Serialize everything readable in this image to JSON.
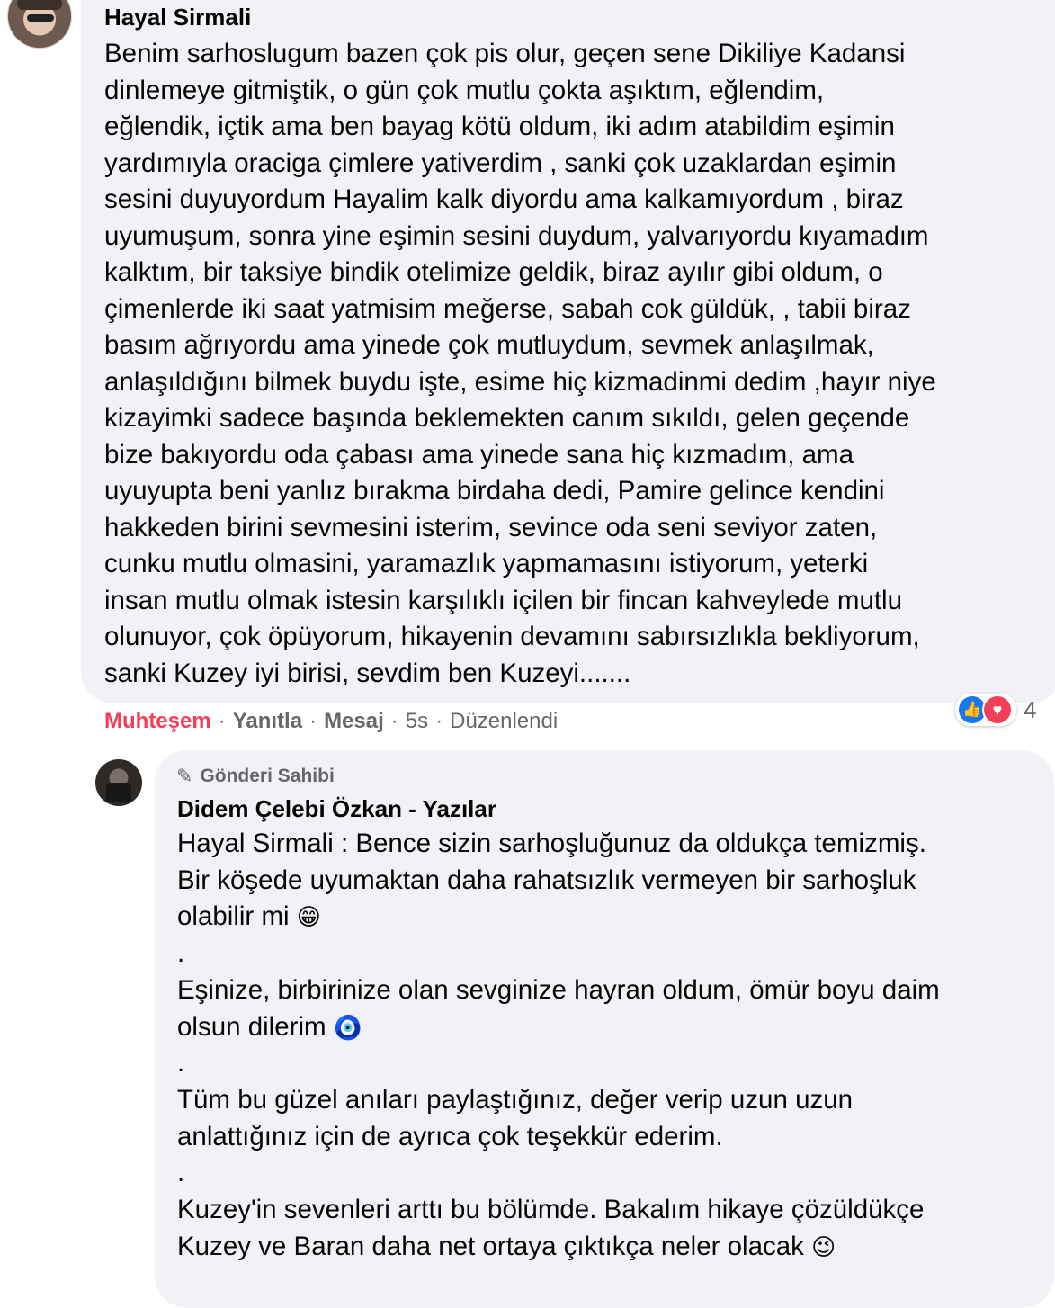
{
  "comment1": {
    "author": "Hayal Sirmali",
    "text": "Benim sarhoslugum bazen çok pis olur, geçen sene Dikiliye Kadansi\ndinlemeye gitmiştik, o gün çok mutlu çokta aşıktım, eğlendim,\neğlendik, içtik ama ben bayag kötü oldum, iki adım atabildim eşimin\nyardımıyla oraciga çimlere yativerdim , sanki çok uzaklardan eşimin\nsesini duyuyordum Hayalim kalk diyordu ama kalkamıyordum , biraz\nuyumuşum, sonra yine eşimin sesini duydum, yalvarıyordu kıyamadım\nkalktım, bir taksiye bindik otelimize geldik, biraz ayılır gibi oldum, o\nçimenlerde iki saat yatmisim meğerse, sabah cok güldük, , tabii biraz\nbasım ağrıyordu ama yinede çok mutluydum, sevmek anlaşılmak,\nanlaşıldığını bilmek buydu işte, esime hiç kizmadinmi dedim ,hayır niye\nkizayimki sadece başında beklemekten canım sıkıldı, gelen geçende\nbize bakıyordu oda çabası ama yinede sana hiç kızmadım, ama\nuyuyupta beni yanlız bırakma birdaha dedi, Pamire gelince kendini\nhakkeden birini sevmesini isterim, sevince oda seni seviyor zaten,\ncunku mutlu olmasini, yaramazlık yapmamasını istiyorum, yeterki\ninsan mutlu olmak istesin karşılıklı içilen bir fincan kahveylede mutlu\nolunuyor, çok öpüyorum, hikayenin devamını sabırsızlıkla bekliyorum,\nsanki Kuzey iyi birisi, sevdim ben Kuzeyi.......",
    "actions": {
      "reaction": "Muhteşem",
      "reply": "Yanıtla",
      "message": "Mesaj",
      "time": "5s",
      "edited": "Düzenlendi"
    },
    "reaction_count": "4",
    "reaction_icons": [
      "like-icon",
      "love-icon"
    ]
  },
  "comment2": {
    "badge": "Gönderi Sahibi",
    "author": "Didem Çelebi Özkan - Yazılar",
    "text_part1": "Hayal Sirmali : Bence sizin sarhoşluğunuz da oldukça temizmiş.\nBir köşede uyumaktan daha rahatsızlık vermeyen bir sarhoşluk\nolabilir mi ",
    "emoji1": "😁",
    "text_part2": "\n.\nEşinize, birbirinize olan sevginize hayran oldum, ömür boyu daim\nolsun dilerim ",
    "emoji2": "🧿",
    "text_part3": "\n.\nTüm bu güzel anıları paylaştığınız, değer verip uzun uzun\nanlattığınız için de ayrıca çok teşekkür ederim.\n.\nKuzey'in sevenleri arttı bu bölümde. Bakalım hikaye çözüldükçe\nKuzey ve Baran daha net ortaya çıktıkça neler olacak ",
    "emoji3": "😉"
  },
  "colors": {
    "bubble": "#f0f2f5",
    "secondary_text": "#65676b",
    "love_red": "#f33e58",
    "like_blue": "#1877f2"
  }
}
